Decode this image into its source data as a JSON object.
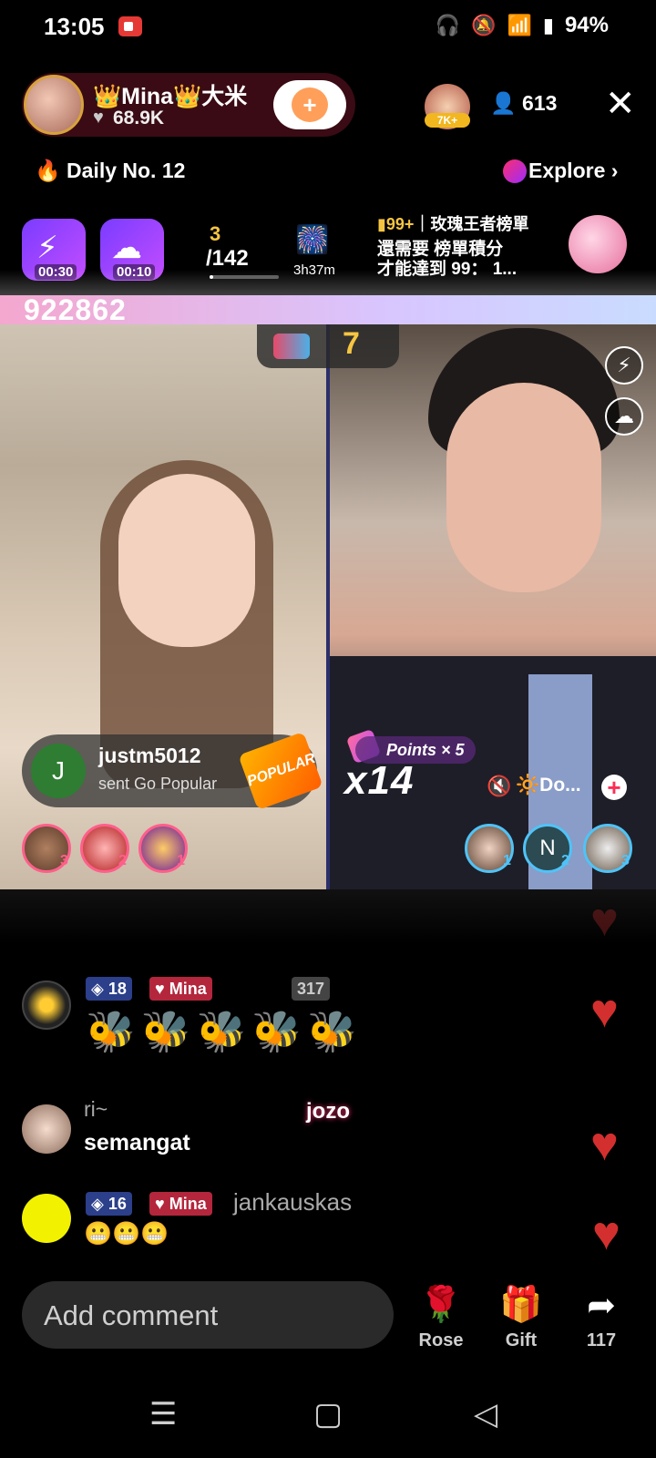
{
  "status": {
    "time": "13:05",
    "battery": "94%",
    "icons": [
      "screen-record-icon",
      "headphones-icon",
      "mute-icon",
      "wifi-icon",
      "volte-icon",
      "signal-icon",
      "battery-icon"
    ]
  },
  "host": {
    "name": "👑Mina👑大米",
    "likes": "68.9K",
    "follow_icon": "heart-plus-icon"
  },
  "top_fan_badge": "7K+",
  "viewers": "613",
  "daily": "Daily No. 12",
  "explore": "Explore",
  "gifts": [
    {
      "time": "00:30",
      "icon": "lightning-icon"
    },
    {
      "time": "00:10",
      "icon": "cloud-icon"
    }
  ],
  "rank": {
    "current": "3",
    "total": "/142",
    "progress": 0.021
  },
  "event_timer": "3h37m",
  "board": {
    "line1_count": "99+",
    "line1_title": "｜玫瑰王者榜單",
    "line2": "還需要 榜單積分",
    "line3": "才能達到 99： 1..."
  },
  "pk_score": "922862",
  "pk_round": "7",
  "notification": {
    "initial": "J",
    "user": "justm5012",
    "text": "sent Go Popular",
    "gift_label": "POPULAR"
  },
  "left_fans": [
    {
      "rank": "3"
    },
    {
      "rank": "2"
    },
    {
      "rank": "1"
    }
  ],
  "right_fans": [
    {
      "initial": "",
      "rank": "1"
    },
    {
      "initial": "N",
      "rank": "2"
    },
    {
      "initial": "",
      "rank": "3"
    }
  ],
  "points": "Points × 5",
  "combo": "x14",
  "right_status": "🔆Do...",
  "chat": [
    {
      "level": "18",
      "fan_badge": "Mina",
      "badge_level": "317",
      "emoji_count": 5
    },
    {
      "name": "ri~",
      "message": "semangat"
    },
    {
      "level": "16",
      "fan_badge": "Mina",
      "name": "jankauskas",
      "message": "😬😬😬"
    }
  ],
  "floating_name": "jozo",
  "bottom": {
    "comment_placeholder": "Add comment",
    "rose": "Rose",
    "gift": "Gift",
    "share_count": "117"
  },
  "colors": {
    "accent": "#f5c542",
    "heart": "#d32f2f",
    "level_badge": "#2b3f8a",
    "fan_badge": "#b3263c"
  }
}
